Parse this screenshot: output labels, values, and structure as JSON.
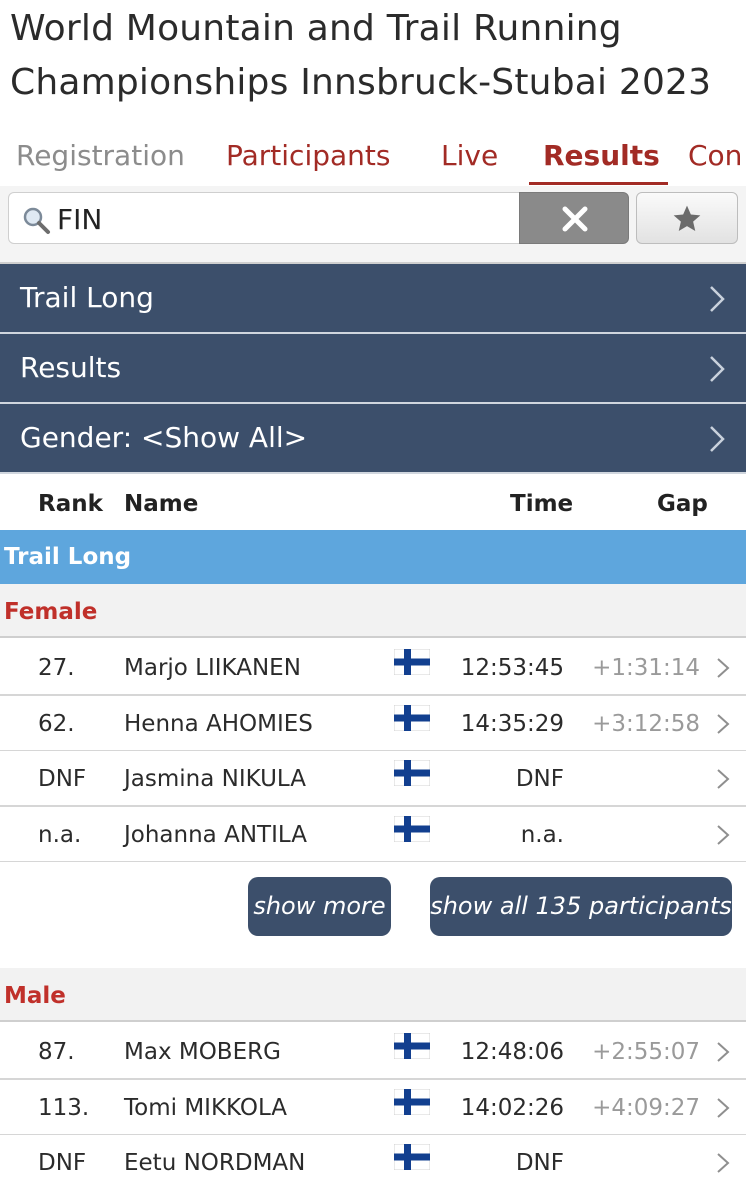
{
  "header": {
    "title_line1": "World Mountain and Trail Running",
    "title_line2": "Championships Innsbruck-Stubai 2023"
  },
  "tabs": [
    {
      "label": "Registration",
      "state": "inactive"
    },
    {
      "label": "Participants",
      "state": "normal"
    },
    {
      "label": "Live",
      "state": "normal"
    },
    {
      "label": "Results",
      "state": "active"
    },
    {
      "label": "Con",
      "state": "normal"
    }
  ],
  "search": {
    "value": "FIN",
    "clear_icon": "close-icon",
    "favorite_icon": "star-icon"
  },
  "filters": [
    {
      "label": "Trail Long"
    },
    {
      "label": "Results"
    },
    {
      "label": "Gender: <Show All>"
    }
  ],
  "columns": {
    "rank": "Rank",
    "name": "Name",
    "time": "Time",
    "gap": "Gap"
  },
  "event": {
    "name": "Trail Long"
  },
  "groups": {
    "female": {
      "label": "Female",
      "rows": [
        {
          "rank": "27.",
          "name": "Marjo LIIKANEN",
          "time": "12:53:45",
          "gap": "+1:31:14"
        },
        {
          "rank": "62.",
          "name": "Henna AHOMIES",
          "time": "14:35:29",
          "gap": "+3:12:58"
        },
        {
          "rank": "DNF",
          "name": "Jasmina NIKULA",
          "time": "DNF",
          "gap": ""
        },
        {
          "rank": "n.a.",
          "name": "Johanna ANTILA",
          "time": "n.a.",
          "gap": ""
        }
      ]
    },
    "male": {
      "label": "Male",
      "rows": [
        {
          "rank": "87.",
          "name": "Max MOBERG",
          "time": "12:48:06",
          "gap": "+2:55:07"
        },
        {
          "rank": "113.",
          "name": "Tomi MIKKOLA",
          "time": "14:02:26",
          "gap": "+4:09:27"
        },
        {
          "rank": "DNF",
          "name": "Eetu NORDMAN",
          "time": "DNF",
          "gap": ""
        }
      ]
    }
  },
  "buttons": {
    "show_more": "show more",
    "show_all": "show all 135 participants"
  },
  "colors": {
    "accent_red": "#a22b25",
    "nav_blue": "#3c4f6b",
    "event_blue": "#5ea6dd",
    "flag_blue": "#123f8f"
  }
}
